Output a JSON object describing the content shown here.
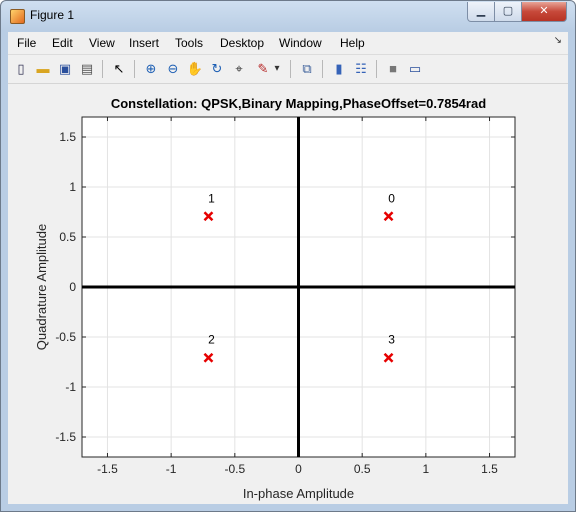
{
  "window": {
    "title": "Figure 1",
    "min_glyph": "▁",
    "max_glyph": "▢",
    "close_glyph": "✕"
  },
  "menu": {
    "items": [
      "File",
      "Edit",
      "View",
      "Insert",
      "Tools",
      "Desktop",
      "Window",
      "Help"
    ],
    "dock_glyph": "↘"
  },
  "toolbar": {
    "icons": [
      {
        "name": "new-figure-icon",
        "glyph": "▯"
      },
      {
        "name": "open-file-icon",
        "glyph": "▬"
      },
      {
        "name": "save-icon",
        "glyph": "▣"
      },
      {
        "name": "print-icon",
        "glyph": "▤"
      },
      {
        "name": "arrow-pointer-icon",
        "glyph": "↖"
      },
      {
        "name": "zoom-in-icon",
        "glyph": "⊕"
      },
      {
        "name": "zoom-out-icon",
        "glyph": "⊖"
      },
      {
        "name": "pan-hand-icon",
        "glyph": "✋"
      },
      {
        "name": "rotate-3d-icon",
        "glyph": "↻"
      },
      {
        "name": "data-cursor-icon",
        "glyph": "⌖"
      },
      {
        "name": "brush-icon",
        "glyph": "✎"
      },
      {
        "name": "brush-dropdown-icon",
        "glyph": "▾"
      },
      {
        "name": "link-plot-icon",
        "glyph": "⧉"
      },
      {
        "name": "colorbar-icon",
        "glyph": "▮"
      },
      {
        "name": "legend-icon",
        "glyph": "☷"
      },
      {
        "name": "hide-plot-tools-icon",
        "glyph": "■"
      },
      {
        "name": "show-plot-tools-icon",
        "glyph": "▭"
      }
    ]
  },
  "chart_data": {
    "type": "scatter",
    "title": "Constellation: QPSK,Binary Mapping,PhaseOffset=0.7854rad",
    "xlabel": "In-phase Amplitude",
    "ylabel": "Quadrature Amplitude",
    "xlim": [
      -1.7,
      1.7
    ],
    "ylim": [
      -1.7,
      1.7
    ],
    "xticks": [
      -1.5,
      -1,
      -0.5,
      0,
      0.5,
      1,
      1.5
    ],
    "yticks": [
      -1.5,
      -1,
      -0.5,
      0,
      0.5,
      1,
      1.5
    ],
    "xtick_labels": [
      "-1.5",
      "-1",
      "-0.5",
      "0",
      "0.5",
      "1",
      "1.5"
    ],
    "ytick_labels": [
      "-1.5",
      "-1",
      "-0.5",
      "0",
      "0.5",
      "1",
      "1.5"
    ],
    "grid": true,
    "marker": "x",
    "marker_color": "#e60000",
    "points": [
      {
        "x": 0.7071,
        "y": 0.7071,
        "label": "0"
      },
      {
        "x": -0.7071,
        "y": 0.7071,
        "label": "1"
      },
      {
        "x": -0.7071,
        "y": -0.7071,
        "label": "2"
      },
      {
        "x": 0.7071,
        "y": -0.7071,
        "label": "3"
      }
    ]
  }
}
